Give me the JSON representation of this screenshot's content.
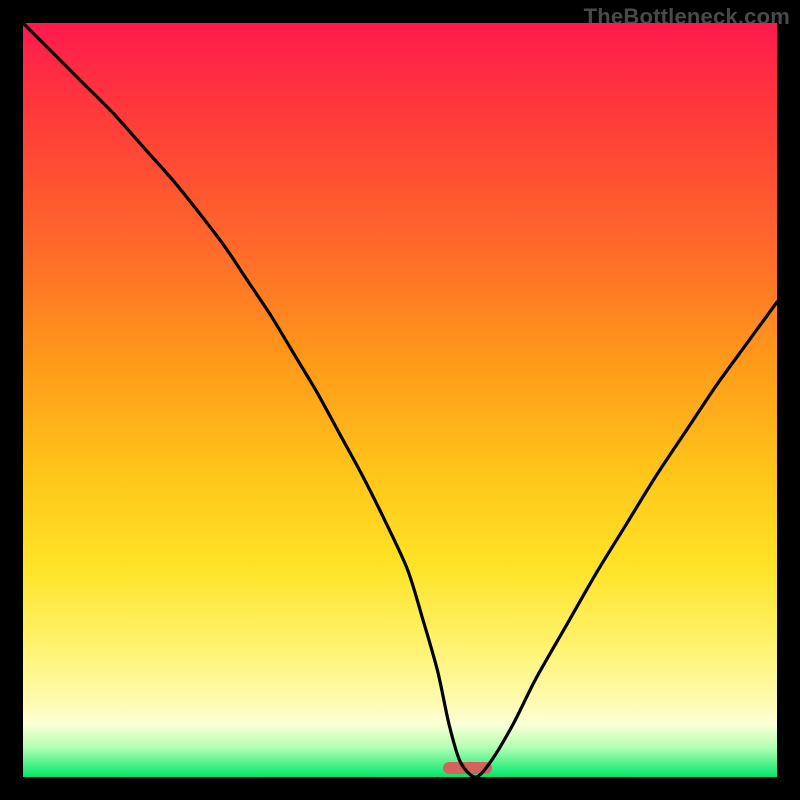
{
  "watermark": "TheBottleneck.com",
  "colors": {
    "frame": "#000000",
    "gradient_top": "#ff1a4d",
    "gradient_bottom": "#00e66a",
    "curve": "#000000",
    "pill": "#d6625d"
  },
  "chart_data": {
    "type": "line",
    "title": "",
    "xlabel": "",
    "ylabel": "",
    "xlim": [
      0,
      100
    ],
    "ylim": [
      0,
      100
    ],
    "grid": false,
    "legend": false,
    "series": [
      {
        "name": "bottleneck-curve",
        "x": [
          0,
          4,
          8,
          12,
          16,
          20,
          24,
          27,
          30,
          33,
          36,
          39,
          42,
          45,
          48,
          51,
          53,
          55,
          56.5,
          58,
          60,
          62,
          65,
          68,
          72,
          76,
          80,
          84,
          88,
          92,
          96,
          100
        ],
        "y": [
          100,
          96,
          92,
          88,
          83.5,
          79,
          74,
          70,
          65.5,
          61,
          56,
          51,
          45.5,
          40,
          34,
          27.5,
          21,
          14,
          7,
          2,
          0,
          2,
          7,
          13,
          20,
          27,
          33.5,
          40,
          46,
          52,
          57.5,
          63
        ],
        "note": "V-shaped curve; minimum around x≈59 at y≈0"
      }
    ],
    "minimum_marker": {
      "x_center": 59,
      "y": 0,
      "width_pct": 6.5
    }
  }
}
